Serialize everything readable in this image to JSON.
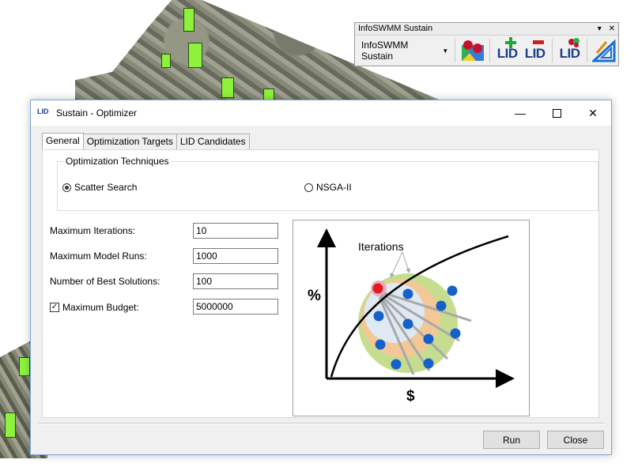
{
  "toolbar": {
    "title": "InfoSWMM Sustain",
    "dropdown_label": "InfoSWMM Sustain",
    "lid_label": "LID"
  },
  "dialog": {
    "app_icon_label": "LID",
    "title": "Sustain - Optimizer",
    "tabs": [
      {
        "label": "General"
      },
      {
        "label": "Optimization Targets"
      },
      {
        "label": "LID Candidates"
      }
    ],
    "techniques": {
      "legend": "Optimization Techniques",
      "options": [
        {
          "label": "Scatter Search",
          "selected": true
        },
        {
          "label": "NSGA-II",
          "selected": false
        }
      ]
    },
    "fields": {
      "max_iterations": {
        "label": "Maximum Iterations:",
        "value": "10"
      },
      "max_model_runs": {
        "label": "Maximum Model Runs:",
        "value": "1000"
      },
      "num_best_solutions": {
        "label": "Number of Best Solutions:",
        "value": "100"
      },
      "max_budget": {
        "label": "Maximum Budget:",
        "value": "5000000",
        "checked": true
      }
    },
    "illustration": {
      "label_iterations": "Iterations",
      "label_y": "%",
      "label_x": "$"
    },
    "buttons": {
      "run": "Run",
      "close": "Close"
    }
  }
}
